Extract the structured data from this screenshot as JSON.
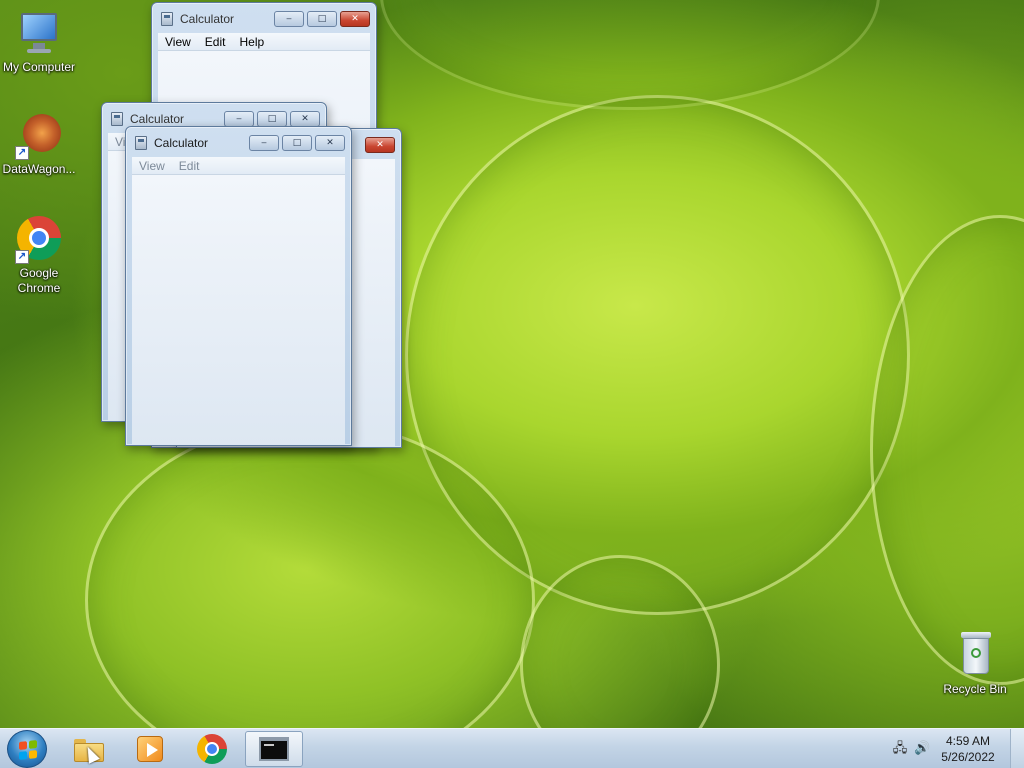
{
  "desktop": {
    "icons": [
      {
        "label": "My Computer",
        "icon": "computer-icon"
      },
      {
        "label": "DataWagon...",
        "icon": "datawagon-icon",
        "shortcut": true
      },
      {
        "label": "Google\nChrome",
        "label_line1": "Google",
        "label_line2": "Chrome",
        "icon": "chrome-icon",
        "shortcut": true
      },
      {
        "label": "Recycle Bin",
        "icon": "recycle-bin-icon"
      }
    ]
  },
  "windows": [
    {
      "title": "Calculator",
      "menu": [
        "View",
        "Edit",
        "Help"
      ],
      "buttons": {
        "minimize": "‒",
        "maximize": "□",
        "close": "✕"
      }
    },
    {
      "title": "Calculator",
      "menu": [
        "View",
        "Edit"
      ],
      "buttons": {
        "minimize": "‒",
        "maximize": "□",
        "close": "✕"
      }
    },
    {
      "title": "Calculator",
      "menu": [
        "View",
        "Edit"
      ],
      "buttons": {
        "minimize": "‒",
        "maximize": "□",
        "close": "✕"
      }
    }
  ],
  "back_window_partial_menu": "Vi",
  "taskbar": {
    "pinned": [
      {
        "name": "File Explorer",
        "icon": "folder-icon"
      },
      {
        "name": "Windows Media Player",
        "icon": "media-player-icon"
      },
      {
        "name": "Google Chrome",
        "icon": "chrome-icon"
      },
      {
        "name": "Command Prompt",
        "icon": "cmd-icon",
        "active": true
      }
    ],
    "clock": {
      "time": "4:59 AM",
      "date": "5/26/2022"
    }
  },
  "colors": {
    "wallpaper_green": "#9cc92a",
    "taskbar": "#c3d4e6",
    "close_button": "#c94631"
  }
}
